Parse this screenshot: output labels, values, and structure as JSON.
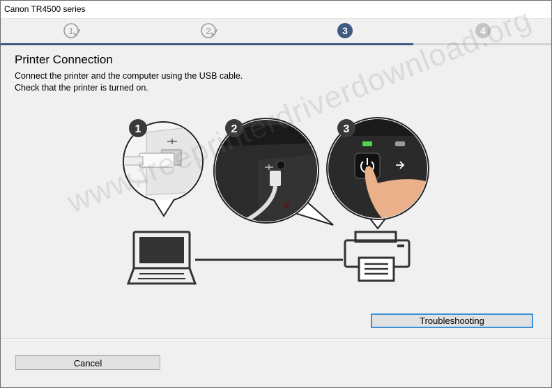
{
  "window": {
    "title": "Canon TR4500 series"
  },
  "steps": [
    {
      "label": "1",
      "state": "done"
    },
    {
      "label": "2",
      "state": "done"
    },
    {
      "label": "3",
      "state": "current"
    },
    {
      "label": "4",
      "state": "upcoming"
    }
  ],
  "page": {
    "heading": "Printer Connection",
    "line1": "Connect the printer and the computer using the USB cable.",
    "line2": "Check that the printer is turned on."
  },
  "illustration": {
    "callouts": [
      "1",
      "2",
      "3"
    ]
  },
  "watermark": "www.freeprinterdriverdownload.org",
  "buttons": {
    "troubleshooting": "Troubleshooting",
    "cancel": "Cancel"
  },
  "colors": {
    "progress_done": "#3d5a80",
    "progress_todo": "#d4d4d4",
    "focus_border": "#3c8fd8",
    "power_led": "#4cd64c"
  }
}
